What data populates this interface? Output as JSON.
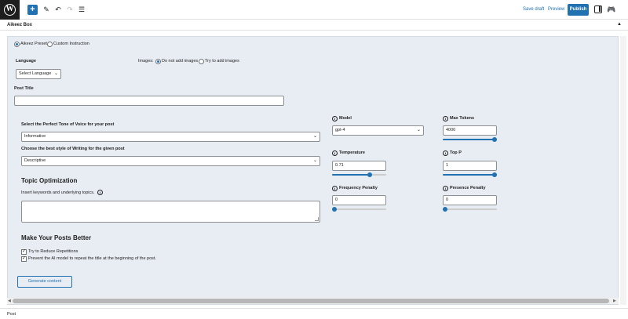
{
  "toolbar": {
    "save_draft": "Save draft",
    "preview": "Preview",
    "publish": "Publish",
    "icons": {
      "logo": "wordpress-logo",
      "add": "plus-icon",
      "edit": "pencil-icon",
      "undo": "undo-icon",
      "redo": "redo-icon",
      "list": "list-view-icon",
      "settings": "sidebar-toggle-icon",
      "plugin": "gamepad-icon"
    }
  },
  "box": {
    "title": "Aikeez Box",
    "toggle": "▲"
  },
  "mode": {
    "preset_label": "Aikeez Preset",
    "custom_label": "Custom Instruction",
    "selected": "preset"
  },
  "language": {
    "label": "Language",
    "selected": "Select Language"
  },
  "images": {
    "label": "Images:",
    "option_no": "Do not add images",
    "option_yes": "Try to add images",
    "selected": "no"
  },
  "post_title": {
    "label": "Post Title",
    "value": ""
  },
  "tone": {
    "label": "Select the Perfect Tone of Voice for your post",
    "selected": "Informative"
  },
  "style": {
    "label": "Choose the best style of Writing for the given post",
    "selected": "Descriptive"
  },
  "topic": {
    "heading": "Topic Optimization",
    "keywords_label": "Insert keywords and underlying topics.",
    "keywords_value": ""
  },
  "better": {
    "heading": "Make Your Posts Better",
    "opt1": "Try to Reduce Repetitions",
    "opt2": "Prevent the AI model to repeat the title at the beginning of the post.",
    "opt1_checked": true,
    "opt2_checked": true
  },
  "params": {
    "model": {
      "label": "Model",
      "selected": "gpt-4"
    },
    "max_tokens": {
      "label": "Max Tokens",
      "value": "4000",
      "slider_fraction": 1.0
    },
    "temperature": {
      "label": "Temperature",
      "value": "0.71",
      "slider_fraction": 0.71
    },
    "top_p": {
      "label": "Top P",
      "value": "1",
      "slider_fraction": 1.0
    },
    "frequency_penalty": {
      "label": "Frequency Penalty",
      "value": "0",
      "slider_fraction": 0.0
    },
    "presence_penalty": {
      "label": "Presence Penalty",
      "value": "0",
      "slider_fraction": 0.0
    }
  },
  "generate_label": "Generate content",
  "footer": "Post",
  "colors": {
    "accent": "#2271b1",
    "panel_bg": "#e8edf3"
  }
}
